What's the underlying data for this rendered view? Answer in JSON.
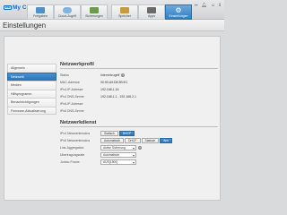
{
  "brand": {
    "name": "My Cloud",
    "logo": "WD"
  },
  "top_icons": [
    "usb-icon",
    "bell-icon",
    "user-icon",
    "help-icon"
  ],
  "nav": [
    {
      "label": "Freigaben",
      "icon": "folder-icon",
      "color": "#4f8fcc",
      "active": false
    },
    {
      "label": "Cloud-Zugriff",
      "icon": "cloud-icon",
      "color": "#7fb3e0",
      "active": false
    },
    {
      "label": "Sicherungen",
      "icon": "backup-icon",
      "color": "#6b9b4f",
      "active": false
    },
    {
      "label": "Speicher",
      "icon": "storage-icon",
      "color": "#c79a3c",
      "active": false
    },
    {
      "label": "Apps",
      "icon": "apps-icon",
      "color": "#6a6a6a",
      "active": false
    },
    {
      "label": "Einstellungen",
      "icon": "gear-icon",
      "color": "#ffffff",
      "active": true
    }
  ],
  "page_title": "Einstellungen",
  "sidebar": [
    {
      "label": "Allgemein",
      "active": false
    },
    {
      "label": "Netzwerk",
      "active": true
    },
    {
      "label": "Medien",
      "active": false
    },
    {
      "label": "Hilfsprogramm",
      "active": false
    },
    {
      "label": "Benachrichtigungen",
      "active": false
    },
    {
      "label": "Firmware-Aktualisierung",
      "active": false
    }
  ],
  "netzwerkprofil": {
    "title": "Netzwerkprofil",
    "rows": [
      {
        "label": "Status",
        "value": "Internetzugriff"
      },
      {
        "label": "MAC-Adresse",
        "value": "00:90:A9:D8:3B:EC"
      },
      {
        "label": "IPv4-IP-Adresse",
        "value": "192.168.1.16"
      },
      {
        "label": "IPv4 DNS-Server",
        "value": "192.168.1.1 ,  192.168.2.1"
      },
      {
        "label": "IPv6-IP-Adresse",
        "value": ""
      },
      {
        "label": "IPv6 DNS-Server",
        "value": ""
      }
    ]
  },
  "netzwerkdienst": {
    "title": "Netzwerkdienst",
    "ipv4_mode": {
      "label": "IPv4 Netzwerkmodus",
      "options": [
        "Statisch",
        "DHCP"
      ],
      "selected": "DHCP"
    },
    "ipv6_mode": {
      "label": "IPv6 Netzwerkmodus",
      "options": [
        "Automatisch",
        "DHCP",
        "Statisch",
        "Aus"
      ],
      "selected": "Aus"
    },
    "link_aggregation": {
      "label": "Link-Aggregation",
      "value": "Aktive Sicherung"
    },
    "transfer_rate": {
      "label": "Übertragungsrate",
      "value": "Automatisch"
    },
    "jumbo_frame": {
      "label": "Jumbo Frame",
      "value": "AUS(1500)"
    }
  },
  "help_glyph": "?"
}
